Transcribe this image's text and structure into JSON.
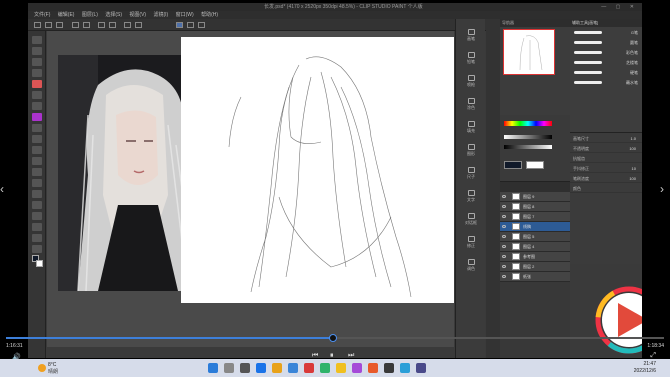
{
  "app": {
    "title": "长发.psd* (4170 x 2520px 350dpi 48.5%)  - CLIP STUDIO PAINT 个人版",
    "window_controls": "— ▢ ✕",
    "menu": [
      "文件(F)",
      "编辑(E)",
      "图层(L)",
      "选择(S)",
      "视图(V)",
      "滤镜(I)",
      "窗口(W)",
      "帮助(H)"
    ]
  },
  "sub_tools": [
    "画笔",
    "铅笔",
    "喷枪",
    "涂色",
    "填充",
    "图形",
    "尺子",
    "文字",
    "对话框",
    "修正",
    "调色"
  ],
  "navigator": {
    "tab": "导航器"
  },
  "brush_panel": {
    "tab": "辅助工具[画笔]",
    "brushes": [
      "G笔",
      "圆笔",
      "彩色笔",
      "芝楼笔",
      "硬笔",
      "蘸水笔"
    ]
  },
  "tool_property": {
    "rows": [
      {
        "label": "画笔尺寸",
        "value": "1.0"
      },
      {
        "label": "不透明度",
        "value": "100"
      },
      {
        "label": "抗锯齿",
        "value": ""
      },
      {
        "label": "手抖修正",
        "value": "10"
      },
      {
        "label": "笔刷浓度",
        "value": "100"
      },
      {
        "label": "颜色",
        "value": ""
      }
    ]
  },
  "layers": [
    {
      "name": "图层 9",
      "selected": false
    },
    {
      "name": "图层 8",
      "selected": false
    },
    {
      "name": "图层 7",
      "selected": false
    },
    {
      "name": "线稿",
      "selected": true
    },
    {
      "name": "图层 5",
      "selected": false
    },
    {
      "name": "图层 4",
      "selected": false
    },
    {
      "name": "参考图",
      "selected": false
    },
    {
      "name": "图层 2",
      "selected": false
    },
    {
      "name": "纸张",
      "selected": false
    }
  ],
  "player": {
    "time_current": "1:16:31",
    "time_total": "1:18:34",
    "progress": 0.497,
    "prev_label": "‹",
    "next_label": "›",
    "vol": "🔊",
    "pbtn_prev": "⏮",
    "pbtn_pause": "⏸",
    "pbtn_next": "⏭",
    "fullscreen": "⤢"
  },
  "taskbar": {
    "weather_temp": "8°C",
    "weather_cond": "晴朗",
    "time": "21:47",
    "date": "2022/12/6"
  },
  "colors": {
    "accent": "#3d7fd9",
    "selected_layer": "#2d5b95"
  }
}
